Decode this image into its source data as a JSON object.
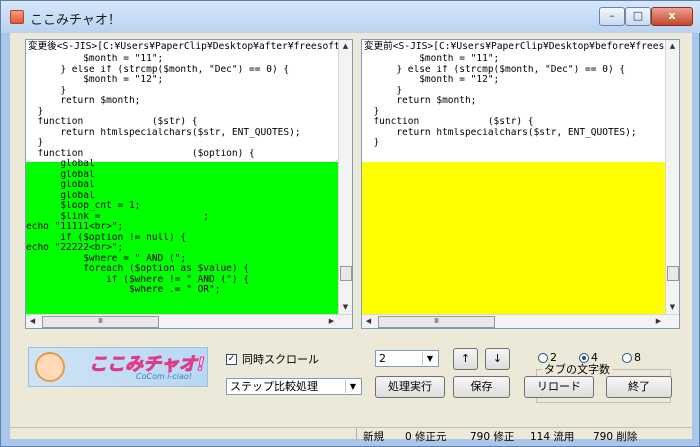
{
  "window": {
    "title": "ここみチャオ！",
    "min_label": "–",
    "max_label": "□",
    "close_label": "x"
  },
  "left_pane": {
    "header": "変更後<S-JIS>[C:¥Users¥PaperClip¥Desktop¥after¥freesoft100fu",
    "lines": [
      "          $month = \"11\";",
      "      } else if (strcmp($month, \"Dec\") == 0) {",
      "          $month = \"12\";",
      "      }",
      "      return $month;",
      "  }",
      "  function            ($str) {",
      "      return htmlspecialchars($str, ENT_QUOTES);",
      "  }",
      "  function                   ($option) {",
      "      global",
      "      global",
      "      global",
      "      global",
      "      $loop_cnt = 1;",
      "      $link =                  ;",
      "echo \"11111<br>\";",
      "      if ($option != null) {",
      "echo \"22222<br>\";",
      "          $where = \" AND (\";",
      "          foreach ($option as $value) {",
      "              if ($where != \" AND (\") {",
      "                  $where .= \" OR\";"
    ],
    "scroll_label": "Ⅲ",
    "highlight_color": "#00ff00"
  },
  "right_pane": {
    "header": "変更前<S-JIS>[C:¥Users¥PaperClip¥Desktop¥before¥freesoft10",
    "lines": [
      "          $month = \"11\";",
      "      } else if (strcmp($month, \"Dec\") == 0) {",
      "          $month = \"12\";",
      "      }",
      "      return $month;",
      "  }",
      "  function            ($str) {",
      "      return htmlspecialchars($str, ENT_QUOTES);",
      "  }"
    ],
    "scroll_label": "Ⅲ",
    "highlight_color": "#ffff00"
  },
  "logo": {
    "text": "ここみチャオ!",
    "subtext": "CoCom i-ciao!"
  },
  "controls": {
    "sync_scroll_label": "同時スクロール",
    "sync_scroll_checked": true,
    "mode_value": "ステップ比較処理",
    "level_value": "2",
    "up_label": "↑",
    "down_label": "↓",
    "run_label": "処理実行",
    "save_label": "保存",
    "reload_label": "リロード",
    "exit_label": "終了",
    "tab_group_label": "タブの文字数",
    "tab_options": [
      "2",
      "4",
      "8"
    ],
    "tab_selected": "4"
  },
  "status": {
    "mode": "新規",
    "modified_src": "0 修正元",
    "modified": "790 修正",
    "moved": "114 流用",
    "deleted": "790 削除"
  }
}
